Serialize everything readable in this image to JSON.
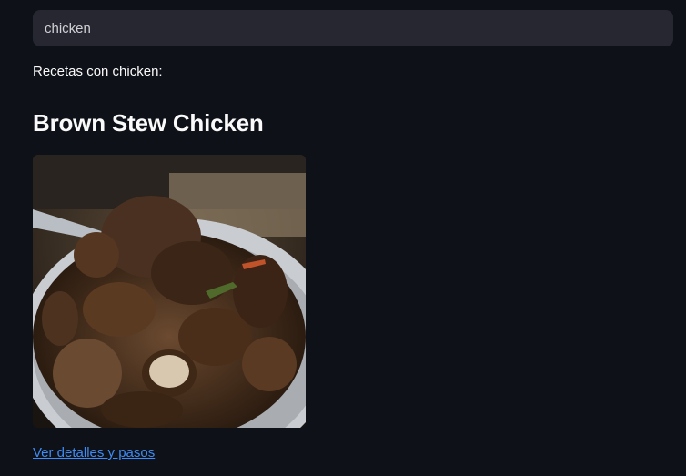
{
  "search": {
    "value": "chicken",
    "placeholder": "chicken"
  },
  "results": {
    "label": "Recetas con chicken:"
  },
  "recipe": {
    "title": "Brown Stew Chicken",
    "link_label": "Ver detalles y pasos"
  },
  "colors": {
    "background": "#0e1117",
    "input_background": "#262730",
    "text": "#fafafa",
    "link": "#3d8bf5"
  }
}
